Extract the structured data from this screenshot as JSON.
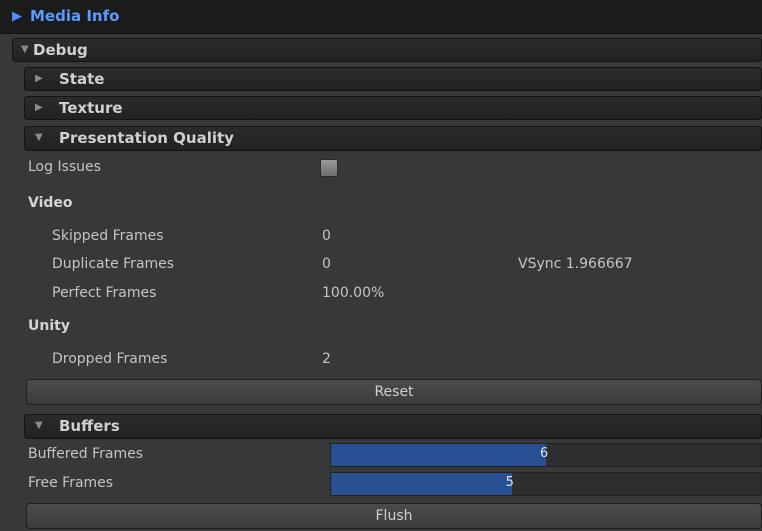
{
  "header": {
    "title": "Media Info"
  },
  "sections": {
    "debug": "Debug",
    "state": "State",
    "texture": "Texture",
    "presentation": "Presentation Quality",
    "buffers": "Buffers"
  },
  "presentation": {
    "log_issues_label": "Log Issues",
    "log_issues_checked": false,
    "video_heading": "Video",
    "skipped_label": "Skipped Frames",
    "skipped_value": "0",
    "duplicate_label": "Duplicate Frames",
    "duplicate_value": "0",
    "vsync_text": "VSync 1.966667",
    "perfect_label": "Perfect Frames",
    "perfect_value": "100.00%",
    "unity_heading": "Unity",
    "dropped_label": "Dropped Frames",
    "dropped_value": "2",
    "reset_label": "Reset"
  },
  "buffers": {
    "buffered_label": "Buffered Frames",
    "buffered_value": "6",
    "buffered_fraction": 0.5,
    "free_label": "Free Frames",
    "free_value": "5",
    "free_fraction": 0.42,
    "flush_label": "Flush"
  },
  "colors": {
    "accent": "#5b9bff",
    "bar_fill": "#274f91",
    "background": "#383838"
  }
}
